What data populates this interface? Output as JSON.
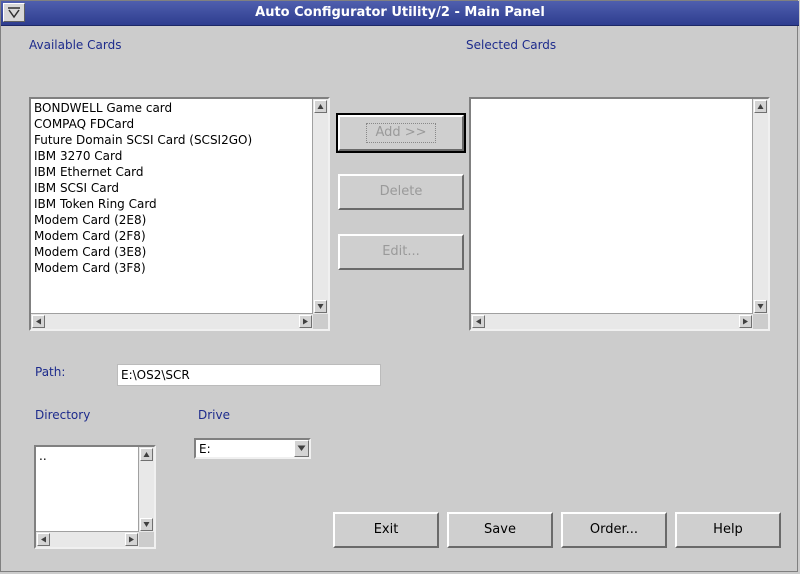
{
  "window": {
    "title": "Auto Configurator Utility/2 - Main Panel"
  },
  "available": {
    "label": "Available Cards",
    "items": [
      "BONDWELL Game card",
      "COMPAQ FDCard",
      "Future Domain SCSI Card (SCSI2GO)",
      "IBM 3270 Card",
      "IBM Ethernet Card",
      "IBM SCSI Card",
      "IBM Token Ring Card",
      "Modem Card (2E8)",
      "Modem Card (2F8)",
      "Modem Card (3E8)",
      "Modem Card (3F8)"
    ]
  },
  "selected": {
    "label": "Selected Cards",
    "items": []
  },
  "actions": {
    "add": {
      "label": "Add >>",
      "enabled": false
    },
    "delete": {
      "label": "Delete",
      "enabled": false
    },
    "edit": {
      "label": "Edit...",
      "enabled": false
    }
  },
  "path": {
    "label": "Path:",
    "value": "E:\\OS2\\SCR"
  },
  "directory": {
    "label": "Directory",
    "items": [
      ".."
    ]
  },
  "drive": {
    "label": "Drive",
    "value": "E:"
  },
  "buttons": {
    "exit": "Exit",
    "save": "Save",
    "order": "Order...",
    "help": "Help"
  },
  "icons": {
    "system_menu": "system-menu-icon",
    "scroll_up": "arrow-up-icon",
    "scroll_down": "arrow-down-icon",
    "scroll_left": "arrow-left-icon",
    "scroll_right": "arrow-right-icon"
  },
  "colors": {
    "titlebar": "#3a4a9e",
    "label_text": "#1d2b8c",
    "background": "#cccccc",
    "disabled_text": "#9a9a9a"
  }
}
